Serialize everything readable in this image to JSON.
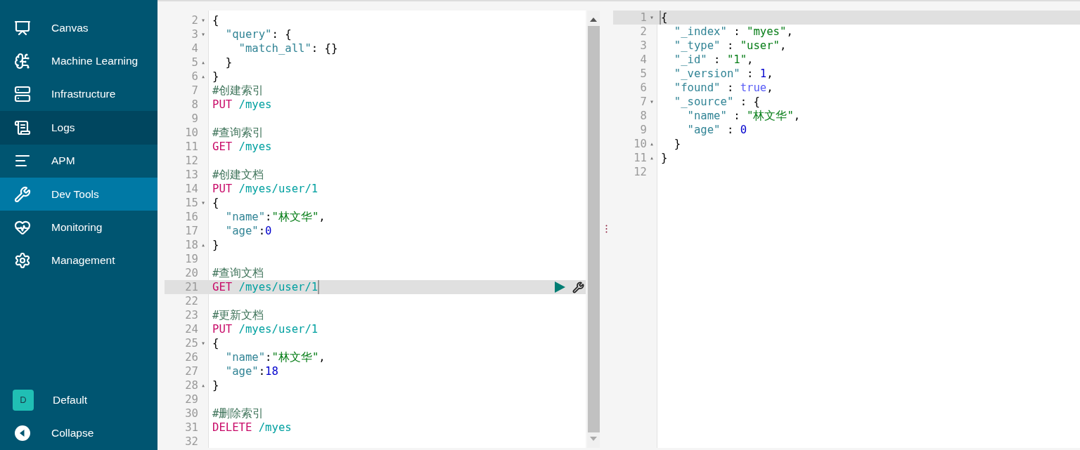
{
  "sidebar": {
    "items": [
      {
        "label": "Canvas",
        "selected": false,
        "hovered": false
      },
      {
        "label": "Machine Learning",
        "selected": false,
        "hovered": false
      },
      {
        "label": "Infrastructure",
        "selected": false,
        "hovered": false
      },
      {
        "label": "Logs",
        "selected": false,
        "hovered": true
      },
      {
        "label": "APM",
        "selected": false,
        "hovered": false
      },
      {
        "label": "Dev Tools",
        "selected": true,
        "hovered": false
      },
      {
        "label": "Monitoring",
        "selected": false,
        "hovered": false
      },
      {
        "label": "Management",
        "selected": false,
        "hovered": false
      }
    ],
    "space": {
      "initial": "D",
      "label": "Default"
    },
    "collapse": {
      "label": "Collapse"
    }
  },
  "request_editor": {
    "lines": [
      {
        "number": "2",
        "fold": "▾",
        "active": false,
        "tokens": [
          {
            "kind": "punct",
            "text": "{"
          }
        ]
      },
      {
        "number": "3",
        "fold": "▾",
        "active": false,
        "tokens": [
          {
            "kind": "key",
            "text": "  \"query\""
          },
          {
            "kind": "punct",
            "text": ": {"
          }
        ]
      },
      {
        "number": "4",
        "active": false,
        "tokens": [
          {
            "kind": "key",
            "text": "    \"match_all\""
          },
          {
            "kind": "punct",
            "text": ": {}"
          }
        ]
      },
      {
        "number": "5",
        "fold": "▴",
        "active": false,
        "tokens": [
          {
            "kind": "punct",
            "text": "  }"
          }
        ]
      },
      {
        "number": "6",
        "fold": "▴",
        "active": false,
        "tokens": [
          {
            "kind": "punct",
            "text": "}"
          }
        ]
      },
      {
        "number": "7",
        "active": false,
        "tokens": [
          {
            "kind": "comment",
            "text": "#创建索引"
          }
        ]
      },
      {
        "number": "8",
        "active": false,
        "tokens": [
          {
            "kind": "method",
            "text": "PUT"
          },
          {
            "kind": "path",
            "text": " /myes"
          }
        ]
      },
      {
        "number": "9",
        "active": false
      },
      {
        "number": "10",
        "active": false,
        "tokens": [
          {
            "kind": "comment",
            "text": "#查询索引"
          }
        ]
      },
      {
        "number": "11",
        "active": false,
        "tokens": [
          {
            "kind": "method",
            "text": "GET"
          },
          {
            "kind": "path",
            "text": " /myes"
          }
        ]
      },
      {
        "number": "12",
        "active": false
      },
      {
        "number": "13",
        "active": false,
        "tokens": [
          {
            "kind": "comment",
            "text": "#创建文档"
          }
        ]
      },
      {
        "number": "14",
        "active": false,
        "tokens": [
          {
            "kind": "method",
            "text": "PUT"
          },
          {
            "kind": "path",
            "text": " /myes/user/1"
          }
        ]
      },
      {
        "number": "15",
        "fold": "▾",
        "active": false,
        "tokens": [
          {
            "kind": "punct",
            "text": "{"
          }
        ]
      },
      {
        "number": "16",
        "active": false,
        "tokens": [
          {
            "kind": "key",
            "text": "  \"name\""
          },
          {
            "kind": "punct",
            "text": ":"
          },
          {
            "kind": "string",
            "text": "\"林文华\""
          },
          {
            "kind": "punct",
            "text": ","
          }
        ]
      },
      {
        "number": "17",
        "active": false,
        "tokens": [
          {
            "kind": "key",
            "text": "  \"age\""
          },
          {
            "kind": "punct",
            "text": ":"
          },
          {
            "kind": "number",
            "text": "0"
          }
        ]
      },
      {
        "number": "18",
        "fold": "▴",
        "active": false,
        "tokens": [
          {
            "kind": "punct",
            "text": "}"
          }
        ]
      },
      {
        "number": "19",
        "active": false
      },
      {
        "number": "20",
        "active": false,
        "tokens": [
          {
            "kind": "comment",
            "text": "#查询文档"
          }
        ]
      },
      {
        "number": "21",
        "active": true,
        "cursor_at_end": true,
        "actions": true,
        "tokens": [
          {
            "kind": "method",
            "text": "GET"
          },
          {
            "kind": "path",
            "text": " /myes/user/1"
          }
        ]
      },
      {
        "number": "22",
        "active": false
      },
      {
        "number": "23",
        "active": false,
        "tokens": [
          {
            "kind": "comment",
            "text": "#更新文档"
          }
        ]
      },
      {
        "number": "24",
        "active": false,
        "tokens": [
          {
            "kind": "method",
            "text": "PUT"
          },
          {
            "kind": "path",
            "text": " /myes/user/1"
          }
        ]
      },
      {
        "number": "25",
        "fold": "▾",
        "active": false,
        "tokens": [
          {
            "kind": "punct",
            "text": "{"
          }
        ]
      },
      {
        "number": "26",
        "active": false,
        "tokens": [
          {
            "kind": "key",
            "text": "  \"name\""
          },
          {
            "kind": "punct",
            "text": ":"
          },
          {
            "kind": "string",
            "text": "\"林文华\""
          },
          {
            "kind": "punct",
            "text": ","
          }
        ]
      },
      {
        "number": "27",
        "active": false,
        "tokens": [
          {
            "kind": "key",
            "text": "  \"age\""
          },
          {
            "kind": "punct",
            "text": ":"
          },
          {
            "kind": "number",
            "text": "18"
          }
        ]
      },
      {
        "number": "28",
        "fold": "▴",
        "active": false,
        "tokens": [
          {
            "kind": "punct",
            "text": "}"
          }
        ]
      },
      {
        "number": "29",
        "active": false
      },
      {
        "number": "30",
        "active": false,
        "tokens": [
          {
            "kind": "comment",
            "text": "#删除索引"
          }
        ]
      },
      {
        "number": "31",
        "active": false,
        "tokens": [
          {
            "kind": "method",
            "text": "DELETE"
          },
          {
            "kind": "path",
            "text": " /myes"
          }
        ]
      },
      {
        "number": "32",
        "active": false
      }
    ]
  },
  "response_editor": {
    "lines": [
      {
        "number": "1",
        "fold": "▾",
        "active": true,
        "cursor_at_end": false,
        "tokens": [
          {
            "kind": "punct",
            "text": "{"
          }
        ]
      },
      {
        "number": "2",
        "active": false,
        "tokens": [
          {
            "kind": "key",
            "text": "  \"_index\""
          },
          {
            "kind": "punct",
            "text": " : "
          },
          {
            "kind": "string",
            "text": "\"myes\""
          },
          {
            "kind": "punct",
            "text": ","
          }
        ]
      },
      {
        "number": "3",
        "active": false,
        "tokens": [
          {
            "kind": "key",
            "text": "  \"_type\""
          },
          {
            "kind": "punct",
            "text": " : "
          },
          {
            "kind": "string",
            "text": "\"user\""
          },
          {
            "kind": "punct",
            "text": ","
          }
        ]
      },
      {
        "number": "4",
        "active": false,
        "tokens": [
          {
            "kind": "key",
            "text": "  \"_id\""
          },
          {
            "kind": "punct",
            "text": " : "
          },
          {
            "kind": "string",
            "text": "\"1\""
          },
          {
            "kind": "punct",
            "text": ","
          }
        ]
      },
      {
        "number": "5",
        "active": false,
        "tokens": [
          {
            "kind": "key",
            "text": "  \"_version\""
          },
          {
            "kind": "punct",
            "text": " : "
          },
          {
            "kind": "number",
            "text": "1"
          },
          {
            "kind": "punct",
            "text": ","
          }
        ]
      },
      {
        "number": "6",
        "active": false,
        "tokens": [
          {
            "kind": "key",
            "text": "  \"found\""
          },
          {
            "kind": "punct",
            "text": " : "
          },
          {
            "kind": "boolean",
            "text": "true"
          },
          {
            "kind": "punct",
            "text": ","
          }
        ]
      },
      {
        "number": "7",
        "fold": "▾",
        "active": false,
        "tokens": [
          {
            "kind": "key",
            "text": "  \"_source\""
          },
          {
            "kind": "punct",
            "text": " : {"
          }
        ]
      },
      {
        "number": "8",
        "active": false,
        "tokens": [
          {
            "kind": "key",
            "text": "    \"name\""
          },
          {
            "kind": "punct",
            "text": " : "
          },
          {
            "kind": "string",
            "text": "\"林文华\""
          },
          {
            "kind": "punct",
            "text": ","
          }
        ]
      },
      {
        "number": "9",
        "active": false,
        "tokens": [
          {
            "kind": "key",
            "text": "    \"age\""
          },
          {
            "kind": "punct",
            "text": " : "
          },
          {
            "kind": "number",
            "text": "0"
          }
        ]
      },
      {
        "number": "10",
        "fold": "▴",
        "active": false,
        "tokens": [
          {
            "kind": "punct",
            "text": "  }"
          }
        ]
      },
      {
        "number": "11",
        "fold": "▴",
        "active": false,
        "tokens": [
          {
            "kind": "punct",
            "text": "}"
          }
        ]
      },
      {
        "number": "12",
        "active": false
      }
    ]
  }
}
